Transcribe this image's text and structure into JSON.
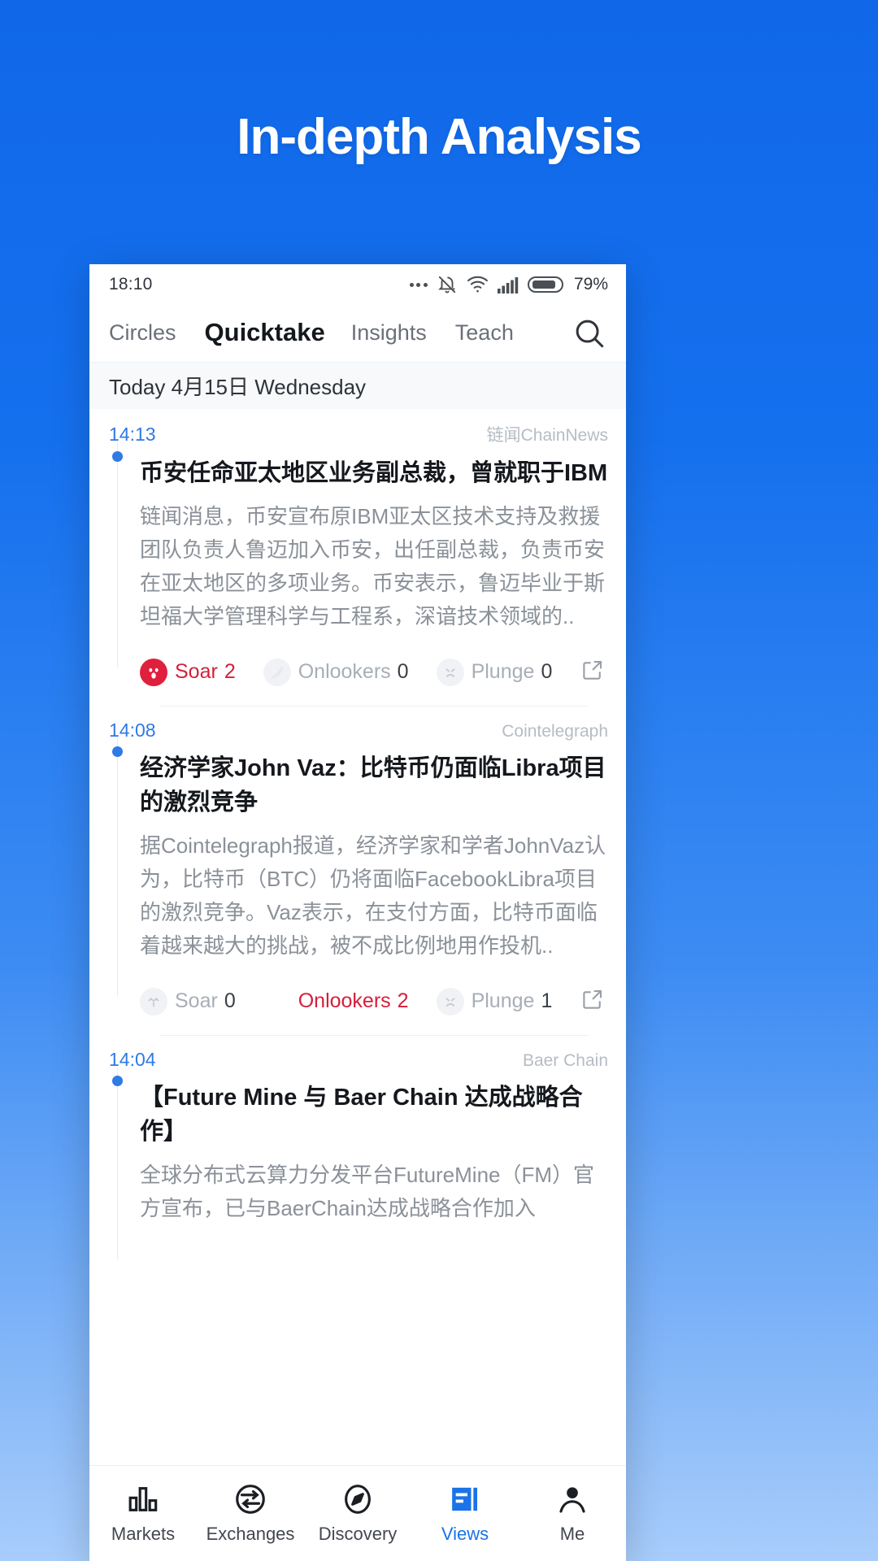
{
  "promo": {
    "title": "In-depth Analysis"
  },
  "colors": {
    "brand_blue": "#1068e8",
    "accent_blue": "#1a73e8",
    "time_blue": "#2f7ae5",
    "active_red": "#d4203c",
    "muted_gray": "#a8aeb6"
  },
  "status_bar": {
    "time": "18:10",
    "battery_percent": "79%",
    "icons": [
      "more-dots-icon",
      "bell-muted-icon",
      "wifi-icon",
      "signal-bars-icon",
      "battery-icon"
    ]
  },
  "top_tabs": {
    "items": [
      {
        "label": "Circles",
        "active": false
      },
      {
        "label": "Quicktake",
        "active": true
      },
      {
        "label": "Insights",
        "active": false
      },
      {
        "label": "Teach",
        "active": false
      }
    ],
    "search_icon": "search-icon"
  },
  "date_header": {
    "text": "Today 4月15日 Wednesday"
  },
  "reaction_labels": {
    "soar": "Soar",
    "onlookers": "Onlookers",
    "plunge": "Plunge"
  },
  "news": [
    {
      "time": "14:13",
      "source": "链闻ChainNews",
      "title": "币安任命亚太地区业务副总裁，曾就职于IBM",
      "text": "链闻消息，币安宣布原IBM亚太区技术支持及救援团队负责人鲁迈加入币安，出任副总裁，负责币安在亚太地区的多项业务。币安表示，鲁迈毕业于斯坦福大学管理科学与工程系，深谙技术领域的..",
      "soar_count": "2",
      "onlookers_count": "0",
      "plunge_count": "0",
      "active_reaction": "soar"
    },
    {
      "time": "14:08",
      "source": "Cointelegraph",
      "title": "经济学家John Vaz：比特币仍面临Libra项目的激烈竞争",
      "text": "据Cointelegraph报道，经济学家和学者JohnVaz认为，比特币（BTC）仍将面临FacebookLibra项目的激烈竞争。Vaz表示，在支付方面，比特币面临着越来越大的挑战，被不成比例地用作投机..",
      "soar_count": "0",
      "onlookers_count": "2",
      "plunge_count": "1",
      "active_reaction": "onlookers"
    },
    {
      "time": "14:04",
      "source": "Baer Chain",
      "title": "【Future Mine 与 Baer Chain 达成战略合作】",
      "text": "全球分布式云算力分发平台FutureMine（FM）官方宣布，已与BaerChain达成战略合作加入",
      "soar_count": "",
      "onlookers_count": "",
      "plunge_count": "",
      "active_reaction": ""
    }
  ],
  "bottom_nav": {
    "items": [
      {
        "label": "Markets",
        "icon": "bar-chart-icon",
        "active": false
      },
      {
        "label": "Exchanges",
        "icon": "exchange-circle-icon",
        "active": false
      },
      {
        "label": "Discovery",
        "icon": "compass-icon",
        "active": false
      },
      {
        "label": "Views",
        "icon": "article-icon",
        "active": true
      },
      {
        "label": "Me",
        "icon": "person-icon",
        "active": false
      }
    ]
  }
}
